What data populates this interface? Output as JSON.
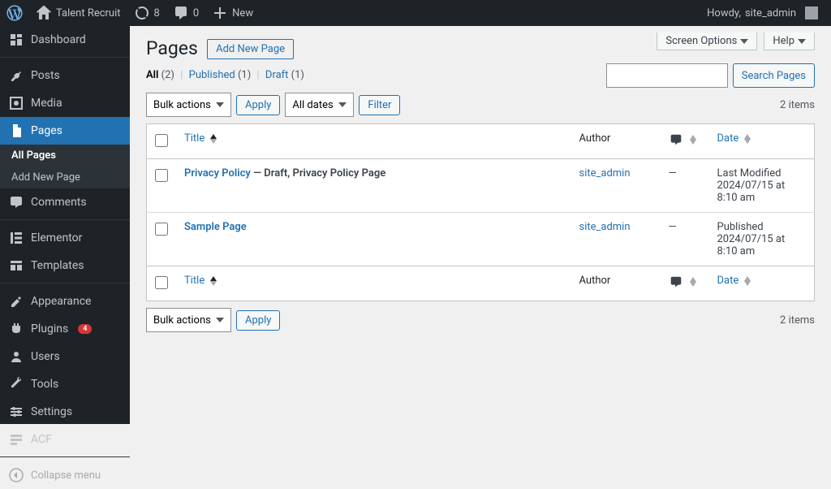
{
  "adminbar": {
    "site_name": "Talent Recruit",
    "updates_count": "8",
    "comments_count": "0",
    "new_label": "New",
    "howdy_prefix": "Howdy, ",
    "user_name": "site_admin"
  },
  "sidebar": {
    "dashboard": "Dashboard",
    "posts": "Posts",
    "media": "Media",
    "pages": "Pages",
    "pages_sub_all": "All Pages",
    "pages_sub_add": "Add New Page",
    "comments": "Comments",
    "elementor": "Elementor",
    "templates": "Templates",
    "appearance": "Appearance",
    "plugins": "Plugins",
    "plugins_badge": "4",
    "users": "Users",
    "tools": "Tools",
    "settings": "Settings",
    "acf": "ACF",
    "collapse": "Collapse menu"
  },
  "header": {
    "title": "Pages",
    "add_new": "Add New Page",
    "screen_options": "Screen Options",
    "help": "Help"
  },
  "filters": {
    "all_label": "All",
    "all_count": "(2)",
    "published_label": "Published",
    "published_count": "(1)",
    "draft_label": "Draft",
    "draft_count": "(1)"
  },
  "search": {
    "button": "Search Pages"
  },
  "bulk": {
    "bulk_actions": "Bulk actions",
    "apply": "Apply",
    "all_dates": "All dates",
    "filter": "Filter",
    "items_count": "2 items"
  },
  "table": {
    "col_title": "Title",
    "col_author": "Author",
    "col_date": "Date",
    "rows": [
      {
        "title": "Privacy Policy",
        "state": " — Draft, Privacy Policy Page",
        "author": "site_admin",
        "comments": "—",
        "date_status": "Last Modified",
        "date_value": "2024/07/15 at 8:10 am"
      },
      {
        "title": "Sample Page",
        "state": "",
        "author": "site_admin",
        "comments": "—",
        "date_status": "Published",
        "date_value": "2024/07/15 at 8:10 am"
      }
    ]
  }
}
